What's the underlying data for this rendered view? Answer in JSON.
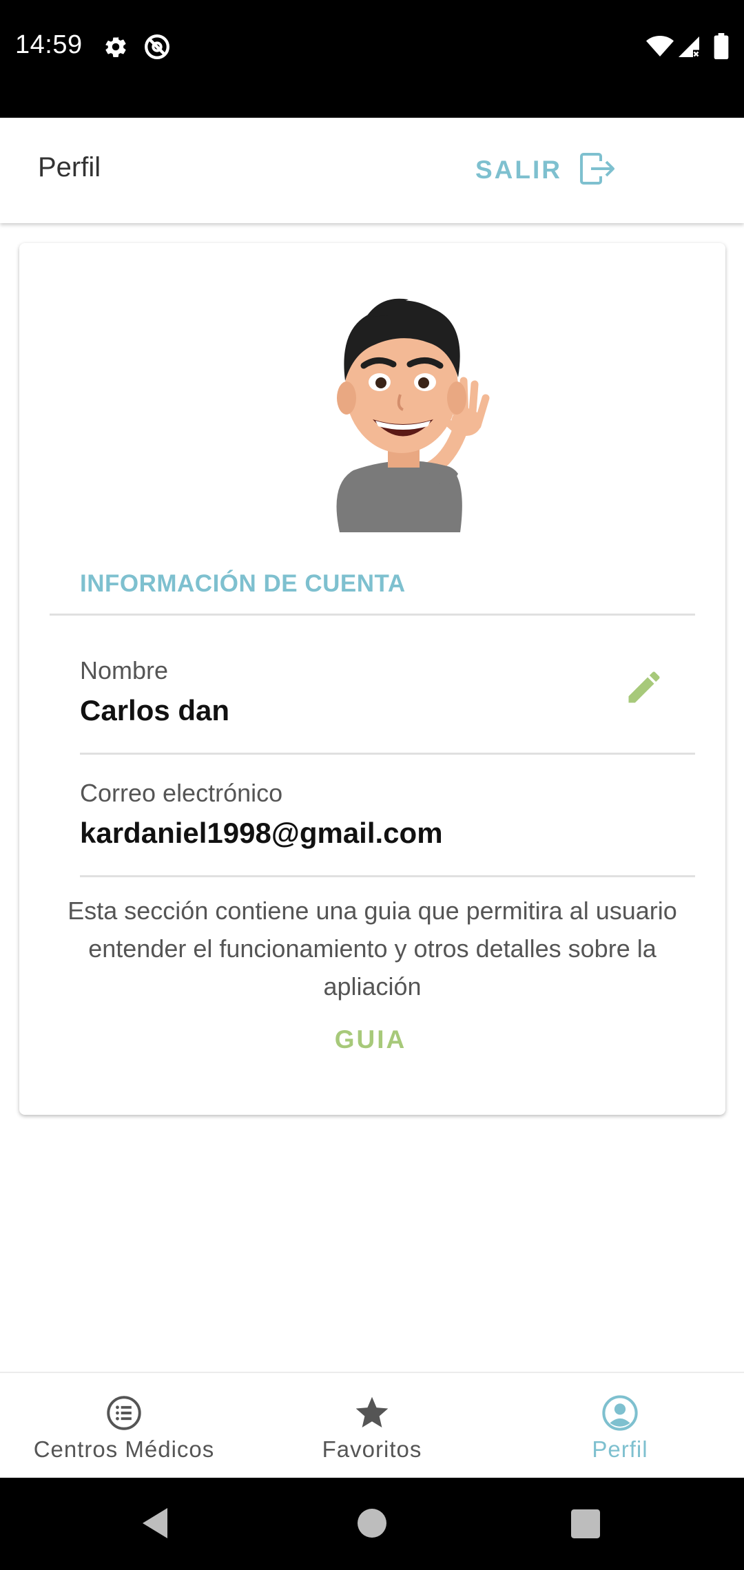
{
  "status_bar": {
    "time": "14:59",
    "icons": [
      "gear-icon",
      "at-sign-icon",
      "wifi-icon",
      "signal-icon",
      "battery-icon"
    ]
  },
  "app_bar": {
    "title": "Perfil",
    "logout_label": "SALIR",
    "logout_icon": "logout-icon"
  },
  "profile": {
    "avatar": "avatar-waving-illustration",
    "section_title": "INFORMACIÓN DE CUENTA",
    "name_label": "Nombre",
    "name_value": "Carlos dan",
    "email_label": "Correo electrónico",
    "email_value": "kardaniel1998@gmail.com",
    "edit_icon": "pencil-icon",
    "guide_description": "Esta sección contiene una guia que permitira al usuario entender el funcionamiento y otros detalles sobre la apliación",
    "guide_button": "GUIA"
  },
  "bottom_nav": {
    "items": [
      {
        "label": "Centros Médicos",
        "icon": "list-icon",
        "active": false
      },
      {
        "label": "Favoritos",
        "icon": "star-icon",
        "active": false
      },
      {
        "label": "Perfil",
        "icon": "account-circle-icon",
        "active": true
      }
    ]
  },
  "colors": {
    "accent": "#7ec0cf",
    "secondary": "#a7c97a",
    "status_bar": "#000000"
  }
}
